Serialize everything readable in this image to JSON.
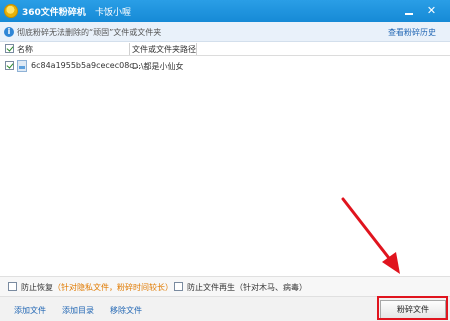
{
  "window": {
    "title": "360文件粉碎机",
    "subtitle": "卡饭小喔"
  },
  "infobar": {
    "text": "彻底粉碎无法删除的“顽固”文件或文件夹",
    "history_link": "查看粉碎历史"
  },
  "list": {
    "columns": [
      "名称",
      "文件或文件夹路径"
    ],
    "rows": [
      {
        "checked": true,
        "name": "6c84a1955b5a9cecec08c...",
        "path": "D:\\都是小仙女"
      }
    ]
  },
  "options": {
    "restore_label": "防止恢复",
    "restore_note": "（针对隐私文件，粉碎时间较长）",
    "regen_label": "防止文件再生（针对木马、病毒）"
  },
  "bottom": {
    "add_file": "添加文件",
    "add_dir": "添加目录",
    "remove_file": "移除文件",
    "shred_button": "粉碎文件"
  },
  "colors": {
    "titlebar": "#1a8fdb",
    "accent_link": "#2267b4",
    "annotation": "#e0141e",
    "note": "#e07a00"
  }
}
